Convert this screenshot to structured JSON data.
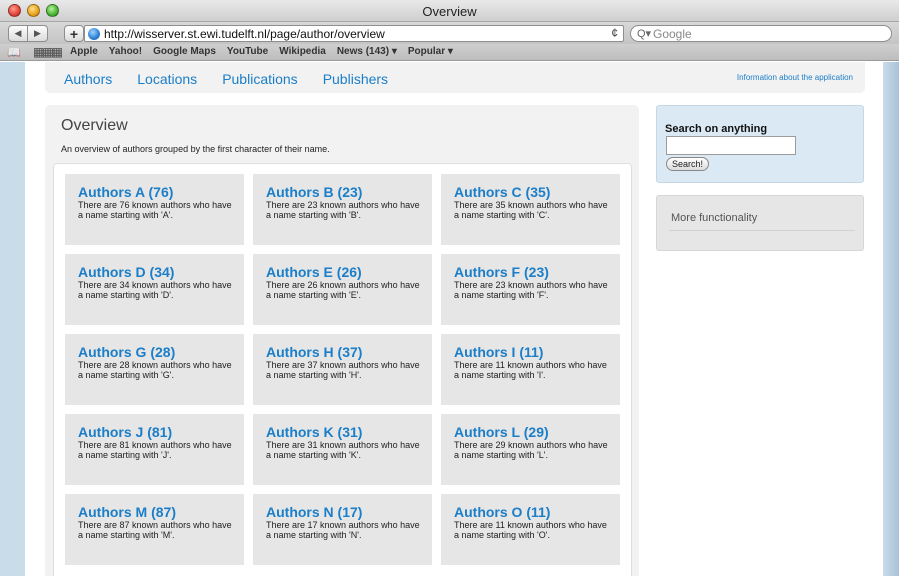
{
  "window": {
    "title": "Overview"
  },
  "browser": {
    "url": "http://wisserver.st.ewi.tudelft.nl/page/author/overview",
    "search_placeholder": "Google",
    "back_symbol": "◀",
    "forward_symbol": "▶",
    "add_symbol": "+",
    "reload_symbol": "¢",
    "search_symbol": "Q▾",
    "bookmarks": [
      "Apple",
      "Yahoo!",
      "Google Maps",
      "YouTube",
      "Wikipedia",
      "News (143) ▾",
      "Popular ▾"
    ]
  },
  "nav": {
    "links": [
      "Authors",
      "Locations",
      "Publications",
      "Publishers"
    ],
    "info": "Information about the application"
  },
  "main": {
    "title": "Overview",
    "subtitle": "An overview of authors grouped by the first character of their name.",
    "tiles": [
      {
        "title": "Authors A (76)",
        "desc": "There are 76 known authors who have a name starting with 'A'."
      },
      {
        "title": "Authors B (23)",
        "desc": "There are 23 known authors who have a name starting with 'B'."
      },
      {
        "title": "Authors C (35)",
        "desc": "There are 35 known authors who have a name starting with 'C'."
      },
      {
        "title": "Authors D (34)",
        "desc": "There are 34 known authors who have a name starting with 'D'."
      },
      {
        "title": "Authors E (26)",
        "desc": "There are 26 known authors who have a name starting with 'E'."
      },
      {
        "title": "Authors F (23)",
        "desc": "There are 23 known authors who have a name starting with 'F'."
      },
      {
        "title": "Authors G (28)",
        "desc": "There are 28 known authors who have a name starting with 'G'."
      },
      {
        "title": "Authors H (37)",
        "desc": "There are 37 known authors who have a name starting with 'H'."
      },
      {
        "title": "Authors I (11)",
        "desc": "There are 11 known authors who have a name starting with 'I'."
      },
      {
        "title": "Authors J (81)",
        "desc": "There are 81 known authors who have a name starting with 'J'."
      },
      {
        "title": "Authors K (31)",
        "desc": "There are 31 known authors who have a name starting with 'K'."
      },
      {
        "title": "Authors L (29)",
        "desc": "There are 29 known authors who have a name starting with 'L'."
      },
      {
        "title": "Authors M (87)",
        "desc": "There are 87 known authors who have a name starting with 'M'."
      },
      {
        "title": "Authors N (17)",
        "desc": "There are 17 known authors who have a name starting with 'N'."
      },
      {
        "title": "Authors O (11)",
        "desc": "There are 11 known authors who have a name starting with 'O'."
      }
    ]
  },
  "sidebar": {
    "search_title": "Search on anything",
    "search_value": "",
    "search_button": "Search!",
    "more": "More functionality"
  },
  "colors": {
    "link": "#1b7ec9",
    "tile_bg": "#e6e6e6",
    "search_box_bg": "#dbe9f5"
  },
  "icons": {
    "nav_back": "back-arrow-icon",
    "nav_forward": "forward-arrow-icon",
    "site": "globe-icon",
    "reload": "reload-icon",
    "search": "magnifier-icon",
    "bookmarks": "book-icon",
    "top_sites": "grid-icon"
  }
}
